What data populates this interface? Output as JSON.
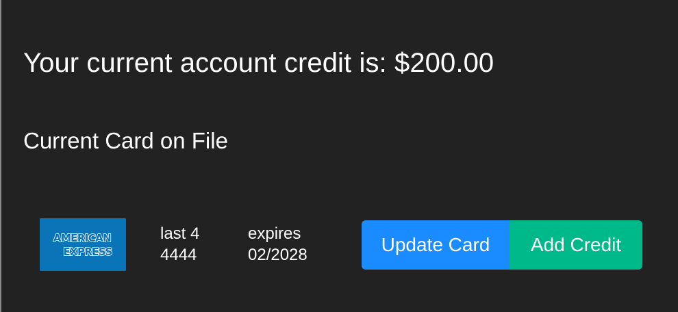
{
  "account": {
    "credit_text": "Your current account credit is: $200.00"
  },
  "card_section": {
    "heading": "Current Card on File",
    "brand_icon": "american-express-logo",
    "brand_lines": [
      "AMERICAN",
      "EXPRESS"
    ],
    "last4_label": "last 4",
    "last4_value": "4444",
    "expires_label": "expires",
    "expires_value": "02/2028"
  },
  "actions": {
    "update_card_label": "Update Card",
    "add_credit_label": "Add Credit"
  },
  "colors": {
    "background": "#222222",
    "amex_blue": "#0a74b8",
    "update_button": "#1a8cff",
    "add_button": "#00b98a"
  }
}
